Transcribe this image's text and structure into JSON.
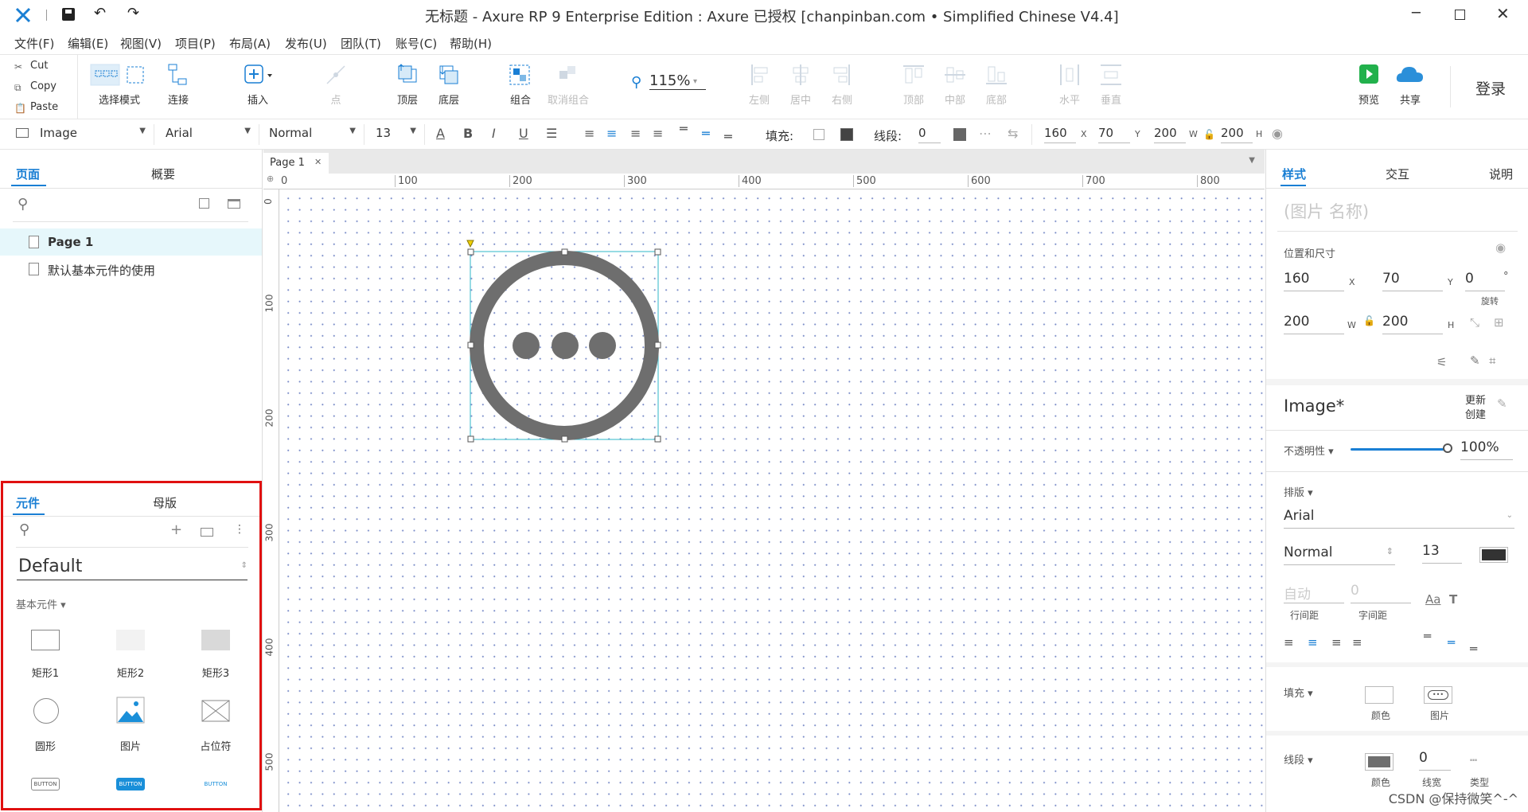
{
  "window": {
    "title": "无标题 - Axure RP 9 Enterprise Edition : Axure 已授权     [chanpinban.com • Simplified Chinese V4.4]"
  },
  "menu": [
    "文件(F)",
    "编辑(E)",
    "视图(V)",
    "项目(P)",
    "布局(A)",
    "发布(U)",
    "团队(T)",
    "账号(C)",
    "帮助(H)"
  ],
  "clipboard": {
    "cut": "Cut",
    "copy": "Copy",
    "paste": "Paste"
  },
  "toolbar": {
    "select_mode": "选择模式",
    "connect": "连接",
    "insert": "插入",
    "point": "点",
    "top_layer": "顶层",
    "bottom_layer": "底层",
    "group": "组合",
    "ungroup": "取消组合",
    "zoom": "115%",
    "align_left": "左侧",
    "align_center": "居中",
    "align_right": "右侧",
    "align_top": "顶部",
    "align_middle": "中部",
    "align_bottom": "底部",
    "dist_horizontal": "水平",
    "dist_vertical": "垂直",
    "preview": "预览",
    "share": "共享",
    "login": "登录"
  },
  "formatbar": {
    "widget_type": "Image",
    "font": "Arial",
    "weight": "Normal",
    "size": "13",
    "fill_label": "填充:",
    "stroke_label": "线段:",
    "stroke_value": "0",
    "x": "160",
    "x_unit": "X",
    "y": "70",
    "y_unit": "Y",
    "w": "200",
    "w_unit": "W",
    "h": "200",
    "h_unit": "H"
  },
  "left_panel": {
    "tabs": {
      "pages": "页面",
      "outline": "概要"
    },
    "pages": [
      "Page 1",
      "默认基本元件的使用"
    ],
    "widget_tabs": {
      "libraries": "元件",
      "masters": "母版"
    },
    "library": "Default",
    "section": "基本元件 ▾",
    "widgets": [
      "矩形1",
      "矩形2",
      "矩形3",
      "圆形",
      "图片",
      "占位符"
    ],
    "button_labels": [
      "BUTTON",
      "BUTTON",
      "BUTTON"
    ]
  },
  "canvas": {
    "tab": "Page 1",
    "ruler_top": [
      "0",
      "100",
      "200",
      "300",
      "400",
      "500",
      "600",
      "700",
      "800"
    ],
    "ruler_left": [
      "0",
      "100",
      "200",
      "300",
      "400",
      "500"
    ]
  },
  "right_panel": {
    "tabs": {
      "style": "样式",
      "interaction": "交互",
      "notes": "说明"
    },
    "name_placeholder": "(图片 名称)",
    "pos_size_label": "位置和尺寸",
    "x": "160",
    "x_unit": "X",
    "y": "70",
    "y_unit": "Y",
    "rotation": "0",
    "rotation_unit": "°",
    "rotation_label": "旋转",
    "w": "200",
    "w_unit": "W",
    "h": "200",
    "h_unit": "H",
    "style_name": "Image*",
    "update_label": "更新",
    "create_label": "创建",
    "opacity_label": "不透明性 ▾",
    "opacity_value": "100%",
    "opacity": 1.0,
    "typography_label": "排版 ▾",
    "font": "Arial",
    "weight": "Normal",
    "size": "13",
    "line_spacing_value": "自动",
    "line_spacing_label": "行间距",
    "char_spacing_value": "0",
    "char_spacing_label": "字间距",
    "fill_label": "填充 ▾",
    "fill_color_label": "颜色",
    "fill_image_label": "图片",
    "stroke_label": "线段 ▾",
    "stroke_color_label": "颜色",
    "stroke_width": "0",
    "stroke_width_label": "线宽",
    "stroke_type_label": "类型"
  },
  "watermark": "CSDN @保持微笑^-^",
  "colors": {
    "accent": "#1a7fd4",
    "selection": "#2fb7c8",
    "highlight": "#e01010",
    "icon_gray": "#6e6e6e"
  }
}
